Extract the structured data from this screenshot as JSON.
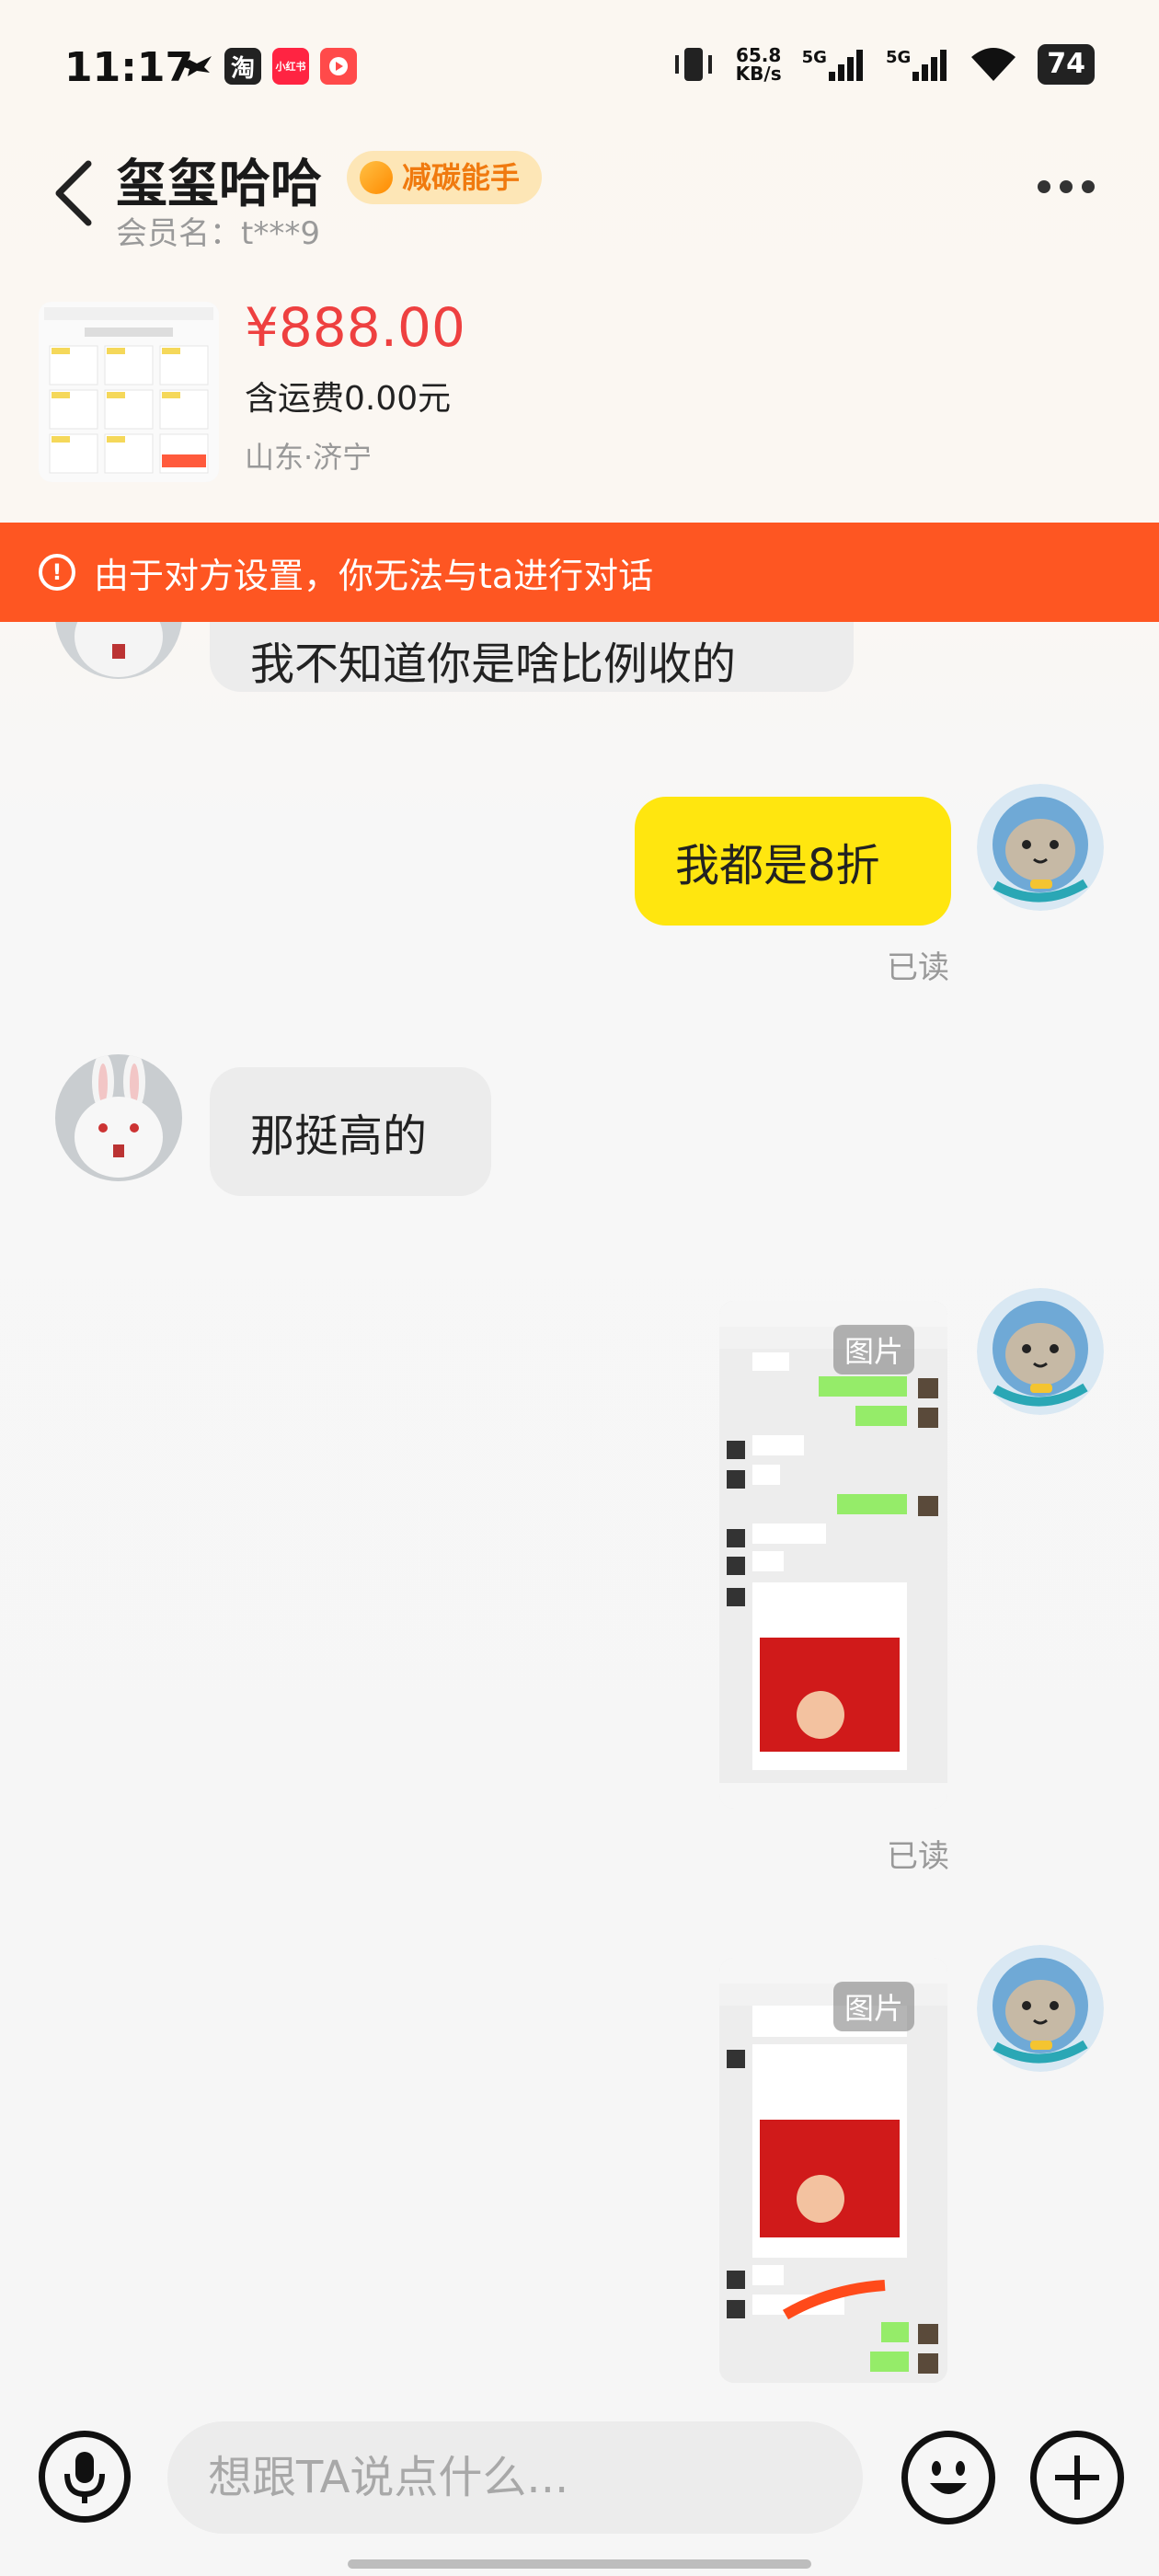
{
  "status_bar": {
    "time": "11:17",
    "apps": [
      {
        "icon": "bird-icon",
        "label": "",
        "color": "#111111"
      },
      {
        "icon": "taobao-icon",
        "label": "淘",
        "color": "#222222"
      },
      {
        "icon": "xiaohongshu-icon",
        "label": "小红书",
        "color": "#ff2442"
      },
      {
        "icon": "video-app-icon",
        "label": "",
        "color": "#ff4a4a"
      }
    ],
    "net_speed_value": "65.8",
    "net_speed_unit": "KB/s",
    "signal_1": "5G",
    "signal_2": "5G",
    "battery": "74"
  },
  "header": {
    "shop_name": "玺玺哈哈",
    "badge": "减碳能手",
    "member": "会员名：t***9"
  },
  "product": {
    "price": "¥888.00",
    "shipping": "含运费0.00元",
    "location": "山东·济宁"
  },
  "banner": {
    "icon": "!",
    "text": "由于对方设置，你无法与ta进行对话"
  },
  "messages": {
    "partial_incoming": "我不知道你是啥比例收的",
    "outgoing_1": "我都是8折",
    "read_1": "已读",
    "incoming_2": "那挺高的",
    "image_tag_1": "图片",
    "read_2": "已读",
    "image_tag_2": "图片"
  },
  "input": {
    "placeholder": "想跟TA说点什么..."
  },
  "colors": {
    "accent_orange": "#fe5622",
    "price_red": "#ee4040",
    "bubble_yellow": "#ffe60f"
  }
}
